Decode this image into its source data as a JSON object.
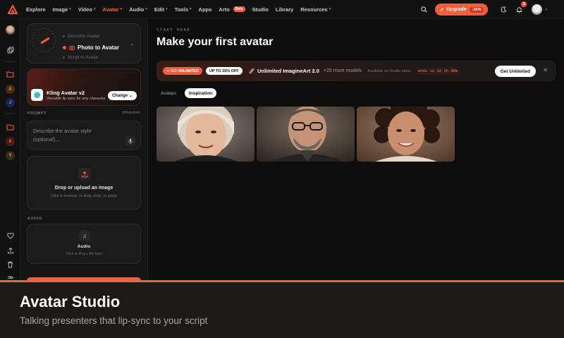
{
  "nav": {
    "items": [
      {
        "label": "Explore",
        "dropdown": false,
        "active": false
      },
      {
        "label": "Image",
        "dropdown": true,
        "active": false
      },
      {
        "label": "Video",
        "dropdown": true,
        "active": false
      },
      {
        "label": "Avatar",
        "dropdown": true,
        "active": true
      },
      {
        "label": "Audio",
        "dropdown": true,
        "active": false
      },
      {
        "label": "Edit",
        "dropdown": true,
        "active": false
      },
      {
        "label": "Tools",
        "dropdown": true,
        "active": false
      },
      {
        "label": "Apps",
        "dropdown": false,
        "active": false
      },
      {
        "label": "Arto",
        "dropdown": false,
        "active": false,
        "badge": "Beta"
      },
      {
        "label": "Studio",
        "dropdown": false,
        "active": false
      },
      {
        "label": "Library",
        "dropdown": false,
        "active": false
      },
      {
        "label": "Resources",
        "dropdown": true,
        "active": false
      }
    ],
    "upgrade_label": "Upgrade",
    "upgrade_discount": "-25%",
    "notification_count": "2",
    "accent": "#ff5a3c"
  },
  "rail": {
    "letters": [
      "A",
      "J",
      "A",
      "T"
    ]
  },
  "panel": {
    "modes": {
      "option1": "Describe Avatar",
      "selected": "Photo to Avatar",
      "option3": "Script to Avatar"
    },
    "model": {
      "name": "Kling Avatar v2",
      "description": "Versatile lip sync for any character",
      "change_label": "Change"
    },
    "prompt": {
      "section_label": "PROMPT",
      "random_label": "Random",
      "placeholder": "Describe the avatar style (optional)..."
    },
    "upload": {
      "title": "Drop or upload an image",
      "subtitle": "Click to browse, or drag, drop, or paste"
    },
    "audio": {
      "section_label": "AUDIO",
      "title": "Audio",
      "subtitle": "Click or drop a file here"
    }
  },
  "main": {
    "kicker": "START HERE",
    "title": "Make your first avatar",
    "promo": {
      "go_label": "GO UNLIMITED",
      "discount_label": "UP TO 25% OFF",
      "title": "Unlimited ImagineArt 2.0",
      "more": "+25 more models",
      "note": "Available on Studio plans",
      "timer": "ends in 1d 1h 48m",
      "cta": "Get Unlimited"
    },
    "tabs": [
      {
        "label": "Avatars",
        "active": false
      },
      {
        "label": "Inspiration",
        "active": true
      }
    ]
  },
  "caption": {
    "title": "Avatar Studio",
    "subtitle": "Talking presenters that lip-sync to your script"
  }
}
